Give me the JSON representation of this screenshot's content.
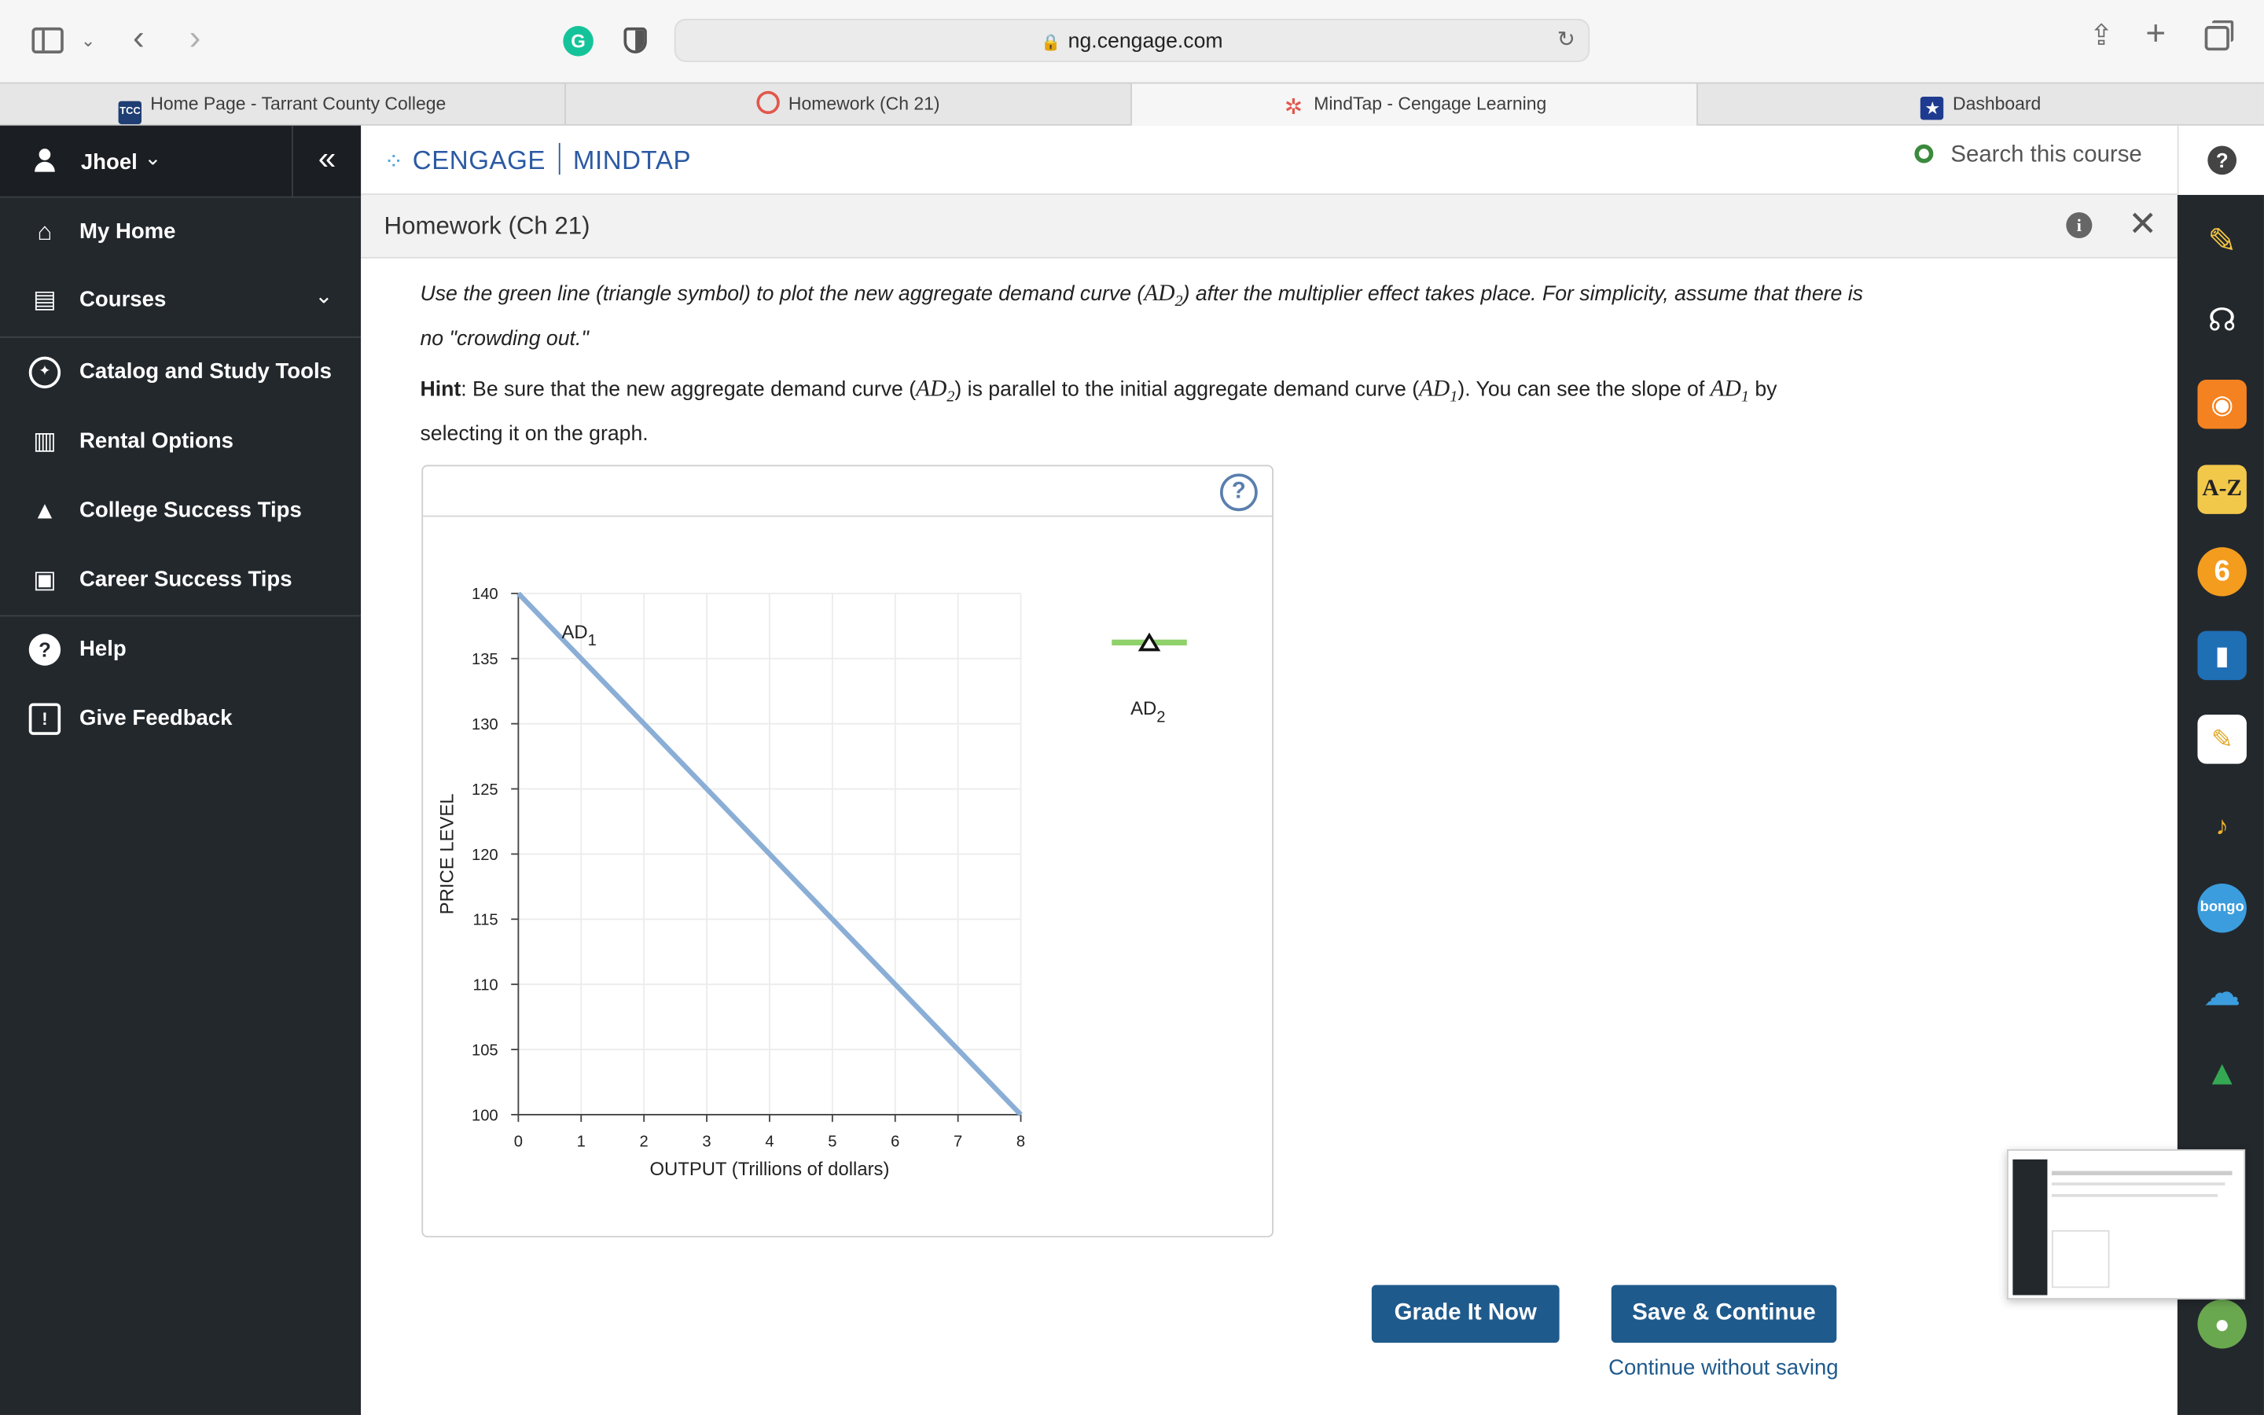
{
  "browser": {
    "url": "ng.cengage.com",
    "tabs": [
      {
        "label": "Home Page - Tarrant County College",
        "favicon_text": "TCC"
      },
      {
        "label": "Homework (Ch 21)"
      },
      {
        "label": "MindTap - Cengage Learning"
      },
      {
        "label": "Dashboard"
      }
    ]
  },
  "sidebar": {
    "user": "Jhoel",
    "items": [
      {
        "label": "My Home",
        "icon": "home-icon"
      },
      {
        "label": "Courses",
        "icon": "book-icon"
      },
      {
        "label": "Catalog and Study Tools",
        "icon": "compass-icon"
      },
      {
        "label": "Rental Options",
        "icon": "open-book-icon"
      },
      {
        "label": "College Success Tips",
        "icon": "graduation-cap-icon"
      },
      {
        "label": "Career Success Tips",
        "icon": "briefcase-icon"
      },
      {
        "label": "Help",
        "icon": "help-icon"
      },
      {
        "label": "Give Feedback",
        "icon": "feedback-icon"
      }
    ]
  },
  "header": {
    "brand_left": "CENGAGE",
    "brand_right": "MINDTAP",
    "search_placeholder": "Search this course"
  },
  "page": {
    "title": "Homework (Ch 21)"
  },
  "instructions": {
    "line1_a": "Use the green line (triangle symbol) to plot the new aggregate demand curve (",
    "ad2": "AD",
    "sub2": "2",
    "line1_b": ") after the multiplier effect takes place. For simplicity, assume that there is no \"crowding out.\"",
    "hint_label": "Hint",
    "hint_a": ": Be sure that the new aggregate demand curve (",
    "hint_b": ") is parallel to the initial aggregate demand curve (",
    "sub1": "1",
    "hint_c": "). You can see the slope of ",
    "hint_d": " by selecting it on the graph."
  },
  "chart_data": {
    "type": "line",
    "xlabel": "OUTPUT (Trillions of dollars)",
    "ylabel": "PRICE LEVEL",
    "xlim": [
      0,
      8
    ],
    "ylim": [
      100,
      140
    ],
    "xticks": [
      0,
      1,
      2,
      3,
      4,
      5,
      6,
      7,
      8
    ],
    "yticks": [
      100,
      105,
      110,
      115,
      120,
      125,
      130,
      135,
      140
    ],
    "grid": true,
    "series": [
      {
        "name": "AD1",
        "label_base": "AD",
        "label_sub": "1",
        "color": "#8aaed6",
        "x": [
          0,
          8
        ],
        "y": [
          140,
          100
        ]
      }
    ],
    "palette": [
      {
        "name": "AD2",
        "label_base": "AD",
        "label_sub": "2",
        "color": "#8fd16a",
        "symbol": "triangle"
      }
    ]
  },
  "actions": {
    "grade": "Grade It Now",
    "save": "Save & Continue",
    "continue": "Continue without saving"
  },
  "colors": {
    "nav_bg": "#23282d",
    "accent": "#1f5a8c",
    "ad1_line": "#8aaed6",
    "ad2_tool": "#8fd16a"
  }
}
